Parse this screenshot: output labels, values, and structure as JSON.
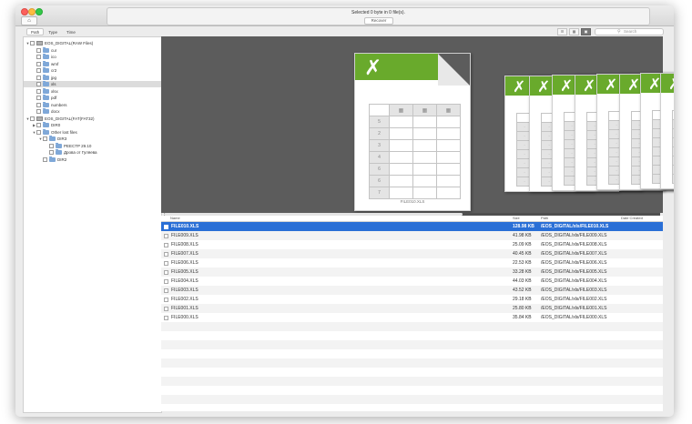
{
  "window": {
    "status_text": "Selected 0 byte in 0 file(s).",
    "recover_label": "Recover",
    "home_icon": "home-icon"
  },
  "tabs": [
    {
      "label": "Path"
    },
    {
      "label": "Type"
    },
    {
      "label": "Time"
    }
  ],
  "view_buttons": [
    "list-view-icon",
    "column-view-icon",
    "cover-flow-view-icon"
  ],
  "search": {
    "placeholder": "Search"
  },
  "tree": [
    {
      "label": "EOS_DIGITAL(RAW Files)"
    },
    {
      "label": "cur"
    },
    {
      "label": "ico"
    },
    {
      "label": "wmf"
    },
    {
      "label": "cr2"
    },
    {
      "label": "jpg"
    },
    {
      "label": "xls"
    },
    {
      "label": "xlsx"
    },
    {
      "label": "pdf"
    },
    {
      "label": "numbers"
    },
    {
      "label": "docx"
    },
    {
      "label": "EOS_DIGITAL(FAT(FAT32)"
    },
    {
      "label": "DIR0"
    },
    {
      "label": "Other lost files"
    },
    {
      "label": "DIR3"
    },
    {
      "label": "PEECTP 29.10"
    },
    {
      "label": "Дрова от Гуляева"
    },
    {
      "label": "DIR2"
    }
  ],
  "preview": {
    "file_name": "FILE010.XLS",
    "row_numbers": [
      "5",
      "2",
      "3",
      "4",
      "6",
      "6",
      "7"
    ]
  },
  "columns": {
    "name": "Name",
    "size": "Size",
    "path": "Path",
    "date": "Date Created"
  },
  "files": [
    {
      "name": "FILE010.XLS",
      "size": "128.98 KB",
      "path": "/EOS_DIGITAL/xls/FILE010.XLS"
    },
    {
      "name": "FILE009.XLS",
      "size": "41.98 KB",
      "path": "/EOS_DIGITAL/xls/FILE009.XLS"
    },
    {
      "name": "FILE008.XLS",
      "size": "25.09 KB",
      "path": "/EOS_DIGITAL/xls/FILE008.XLS"
    },
    {
      "name": "FILE007.XLS",
      "size": "40.45 KB",
      "path": "/EOS_DIGITAL/xls/FILE007.XLS"
    },
    {
      "name": "FILE006.XLS",
      "size": "22.53 KB",
      "path": "/EOS_DIGITAL/xls/FILE006.XLS"
    },
    {
      "name": "FILE005.XLS",
      "size": "33.28 KB",
      "path": "/EOS_DIGITAL/xls/FILE005.XLS"
    },
    {
      "name": "FILE004.XLS",
      "size": "44.03 KB",
      "path": "/EOS_DIGITAL/xls/FILE004.XLS"
    },
    {
      "name": "FILE003.XLS",
      "size": "43.52 KB",
      "path": "/EOS_DIGITAL/xls/FILE003.XLS"
    },
    {
      "name": "FILE002.XLS",
      "size": "29.18 KB",
      "path": "/EOS_DIGITAL/xls/FILE002.XLS"
    },
    {
      "name": "FILE001.XLS",
      "size": "25.80 KB",
      "path": "/EOS_DIGITAL/xls/FILE001.XLS"
    },
    {
      "name": "FILE000.XLS",
      "size": "35.84 KB",
      "path": "/EOS_DIGITAL/xls/FILE000.XLS"
    }
  ],
  "colors": {
    "accent": "#2a6fd6",
    "excel_green": "#69aa2c",
    "preview_bg": "#5c5c5c"
  }
}
